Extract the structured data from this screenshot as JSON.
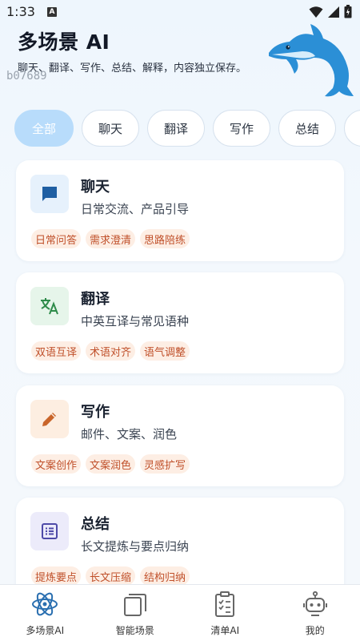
{
  "status_bar": {
    "time": "1:33",
    "notification": "A"
  },
  "header": {
    "title": "多场景 AI",
    "subtitle": "聊天、翻译、写作、总结、解释，内容独立保存。",
    "watermark": "b07689"
  },
  "filter_chips": [
    {
      "label": "全部",
      "active": true
    },
    {
      "label": "聊天",
      "active": false
    },
    {
      "label": "翻译",
      "active": false
    },
    {
      "label": "写作",
      "active": false
    },
    {
      "label": "总结",
      "active": false
    },
    {
      "label": "",
      "active": false
    }
  ],
  "scenes": [
    {
      "icon": "chat-bubble-icon",
      "title": "聊天",
      "description": "日常交流、产品引导",
      "tags": [
        "日常问答",
        "需求澄清",
        "思路陪练"
      ],
      "icon_bg": "#e6f1fc",
      "icon_color": "#1f5fa3"
    },
    {
      "icon": "translate-icon",
      "title": "翻译",
      "description": "中英互译与常见语种",
      "tags": [
        "双语互译",
        "术语对齐",
        "语气调整"
      ],
      "icon_bg": "#e6f5ea",
      "icon_color": "#2e8b4a"
    },
    {
      "icon": "pencil-icon",
      "title": "写作",
      "description": "邮件、文案、润色",
      "tags": [
        "文案创作",
        "文案润色",
        "灵感扩写"
      ],
      "icon_bg": "#fdeee1",
      "icon_color": "#c9652a"
    },
    {
      "icon": "list-icon",
      "title": "总结",
      "description": "长文提炼与要点归纳",
      "tags": [
        "提炼要点",
        "长文压缩",
        "结构归纳"
      ],
      "icon_bg": "#ecebfa",
      "icon_color": "#4e4aa8"
    }
  ],
  "bottom_nav": [
    {
      "label": "多场景AI",
      "icon": "atom-icon",
      "active": true
    },
    {
      "label": "智能场景",
      "icon": "stacked-cards-icon",
      "active": false
    },
    {
      "label": "清单AI",
      "icon": "checklist-icon",
      "active": false
    },
    {
      "label": "我的",
      "icon": "robot-icon",
      "active": false
    }
  ],
  "colors": {
    "accent": "#2a6fb0",
    "chip_active": "#b8dcfb",
    "tag_bg": "#fdeee4",
    "tag_text": "#c0502a"
  }
}
